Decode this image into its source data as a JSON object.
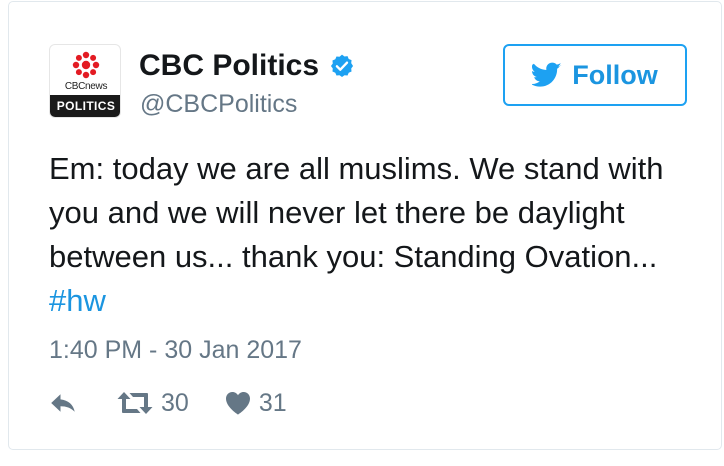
{
  "author": {
    "name": "CBC Politics",
    "handle": "@CBCPolitics",
    "avatar_brand": "CBCnews",
    "avatar_label": "POLITICS"
  },
  "follow_button": {
    "label": "Follow"
  },
  "tweet": {
    "text": "Em: today we are all muslims. We stand with you and we will never let there be daylight between us... thank you: Standing Ovation... ",
    "hashtag": "#hw",
    "timestamp": "1:40 PM - 30 Jan 2017"
  },
  "actions": {
    "retweets": "30",
    "likes": "31"
  },
  "colors": {
    "accent": "#1b95e0",
    "muted": "#657786",
    "text": "#14171a",
    "border": "#e1e8ed",
    "cbc_red": "#e31b23"
  },
  "icons": {
    "verified": "verified-badge-icon",
    "follow": "twitter-bird-icon",
    "reply": "reply-icon",
    "retweet": "retweet-icon",
    "like": "heart-icon"
  }
}
